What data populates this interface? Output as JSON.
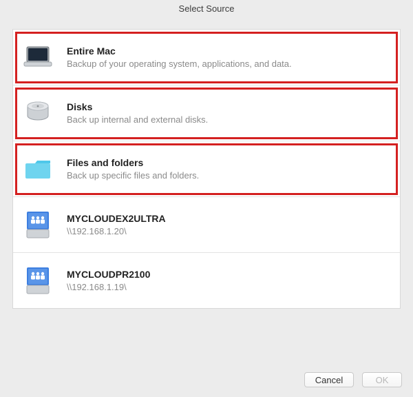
{
  "window": {
    "title": "Select Source"
  },
  "options": [
    {
      "id": "entire-mac",
      "icon": "macbook-icon",
      "title": "Entire Mac",
      "subtitle": "Backup of your operating system, applications, and data.",
      "highlighted": true
    },
    {
      "id": "disks",
      "icon": "harddrive-icon",
      "title": "Disks",
      "subtitle": "Back up internal and external disks.",
      "highlighted": true
    },
    {
      "id": "files-folders",
      "icon": "folder-icon",
      "title": "Files and folders",
      "subtitle": "Back up specific files and folders.",
      "highlighted": true
    },
    {
      "id": "share-mycloudex2ultra",
      "icon": "network-share-icon",
      "title": "MYCLOUDEX2ULTRA",
      "subtitle": "\\\\192.168.1.20\\",
      "highlighted": false
    },
    {
      "id": "share-mycloudpr2100",
      "icon": "network-share-icon",
      "title": "MYCLOUDPR2100",
      "subtitle": "\\\\192.168.1.19\\",
      "highlighted": false
    }
  ],
  "buttons": {
    "cancel": "Cancel",
    "ok": "OK",
    "ok_enabled": false
  }
}
